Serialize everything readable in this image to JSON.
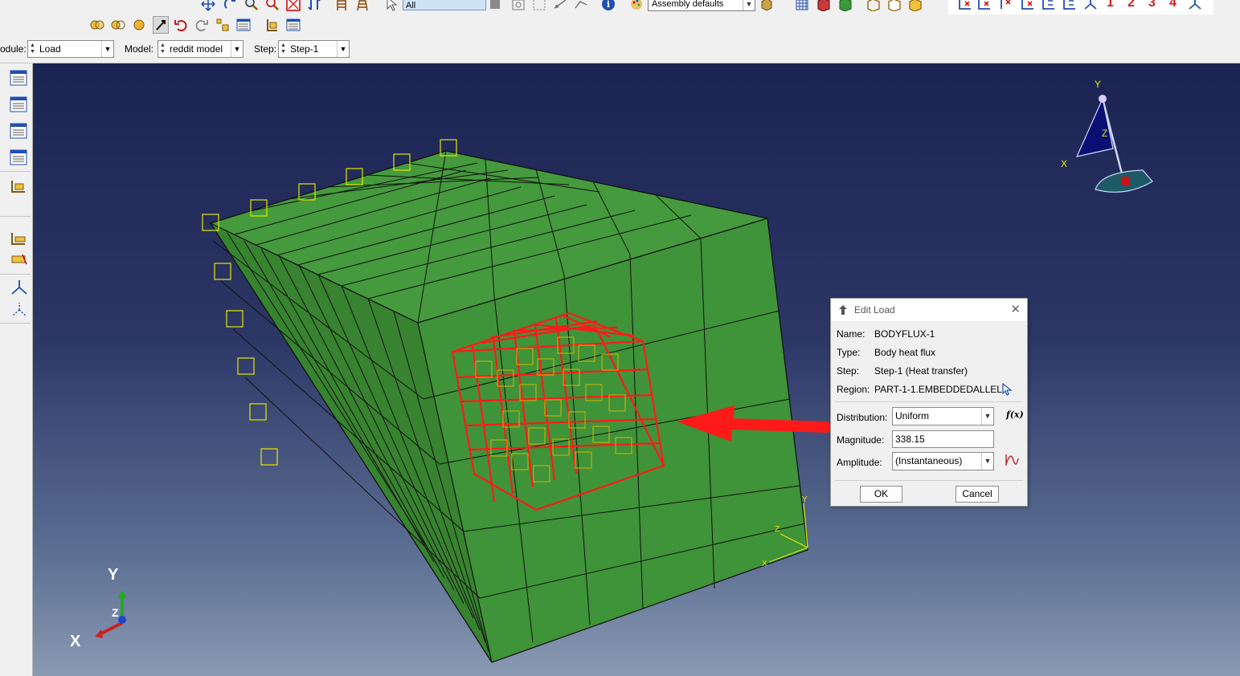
{
  "toolbar": {
    "selection_filter": "All",
    "render_style": "Assembly defaults",
    "numbers": [
      "1",
      "2",
      "3",
      "4"
    ]
  },
  "context": {
    "module_label": "odule:",
    "module_value": "Load",
    "model_label": "Model:",
    "model_value": "reddit model",
    "step_label": "Step:",
    "step_value": "Step-1"
  },
  "viewport": {
    "triad_labels": {
      "y": "Y",
      "z": "Z",
      "x": "X"
    },
    "local_csys_labels": {
      "y": "Y",
      "z": "Z",
      "x": "X"
    },
    "view_triad_labels": {
      "y": "Y",
      "z": "Z",
      "x": "X"
    }
  },
  "dialog": {
    "title": "Edit Load",
    "name_label": "Name:",
    "name_value": "BODYFLUX-1",
    "type_label": "Type:",
    "type_value": "Body heat flux",
    "step_label": "Step:",
    "step_value": "Step-1 (Heat transfer)",
    "region_label": "Region:",
    "region_value": "PART-1-1.EMBEDDEDALLEL",
    "distribution_label": "Distribution:",
    "distribution_value": "Uniform",
    "fx_label": "f(x)",
    "magnitude_label": "Magnitude:",
    "magnitude_value": "338.15",
    "amplitude_label": "Amplitude:",
    "amplitude_value": "(Instantaneous)",
    "ok_label": "OK",
    "cancel_label": "Cancel"
  },
  "colors": {
    "mesh_green": "#3d8f35",
    "embedded_red": "#ff1a1a",
    "marker_yellow": "#e6e600",
    "viewport_top": "#1b2352",
    "viewport_bottom": "#8a9ab3"
  }
}
